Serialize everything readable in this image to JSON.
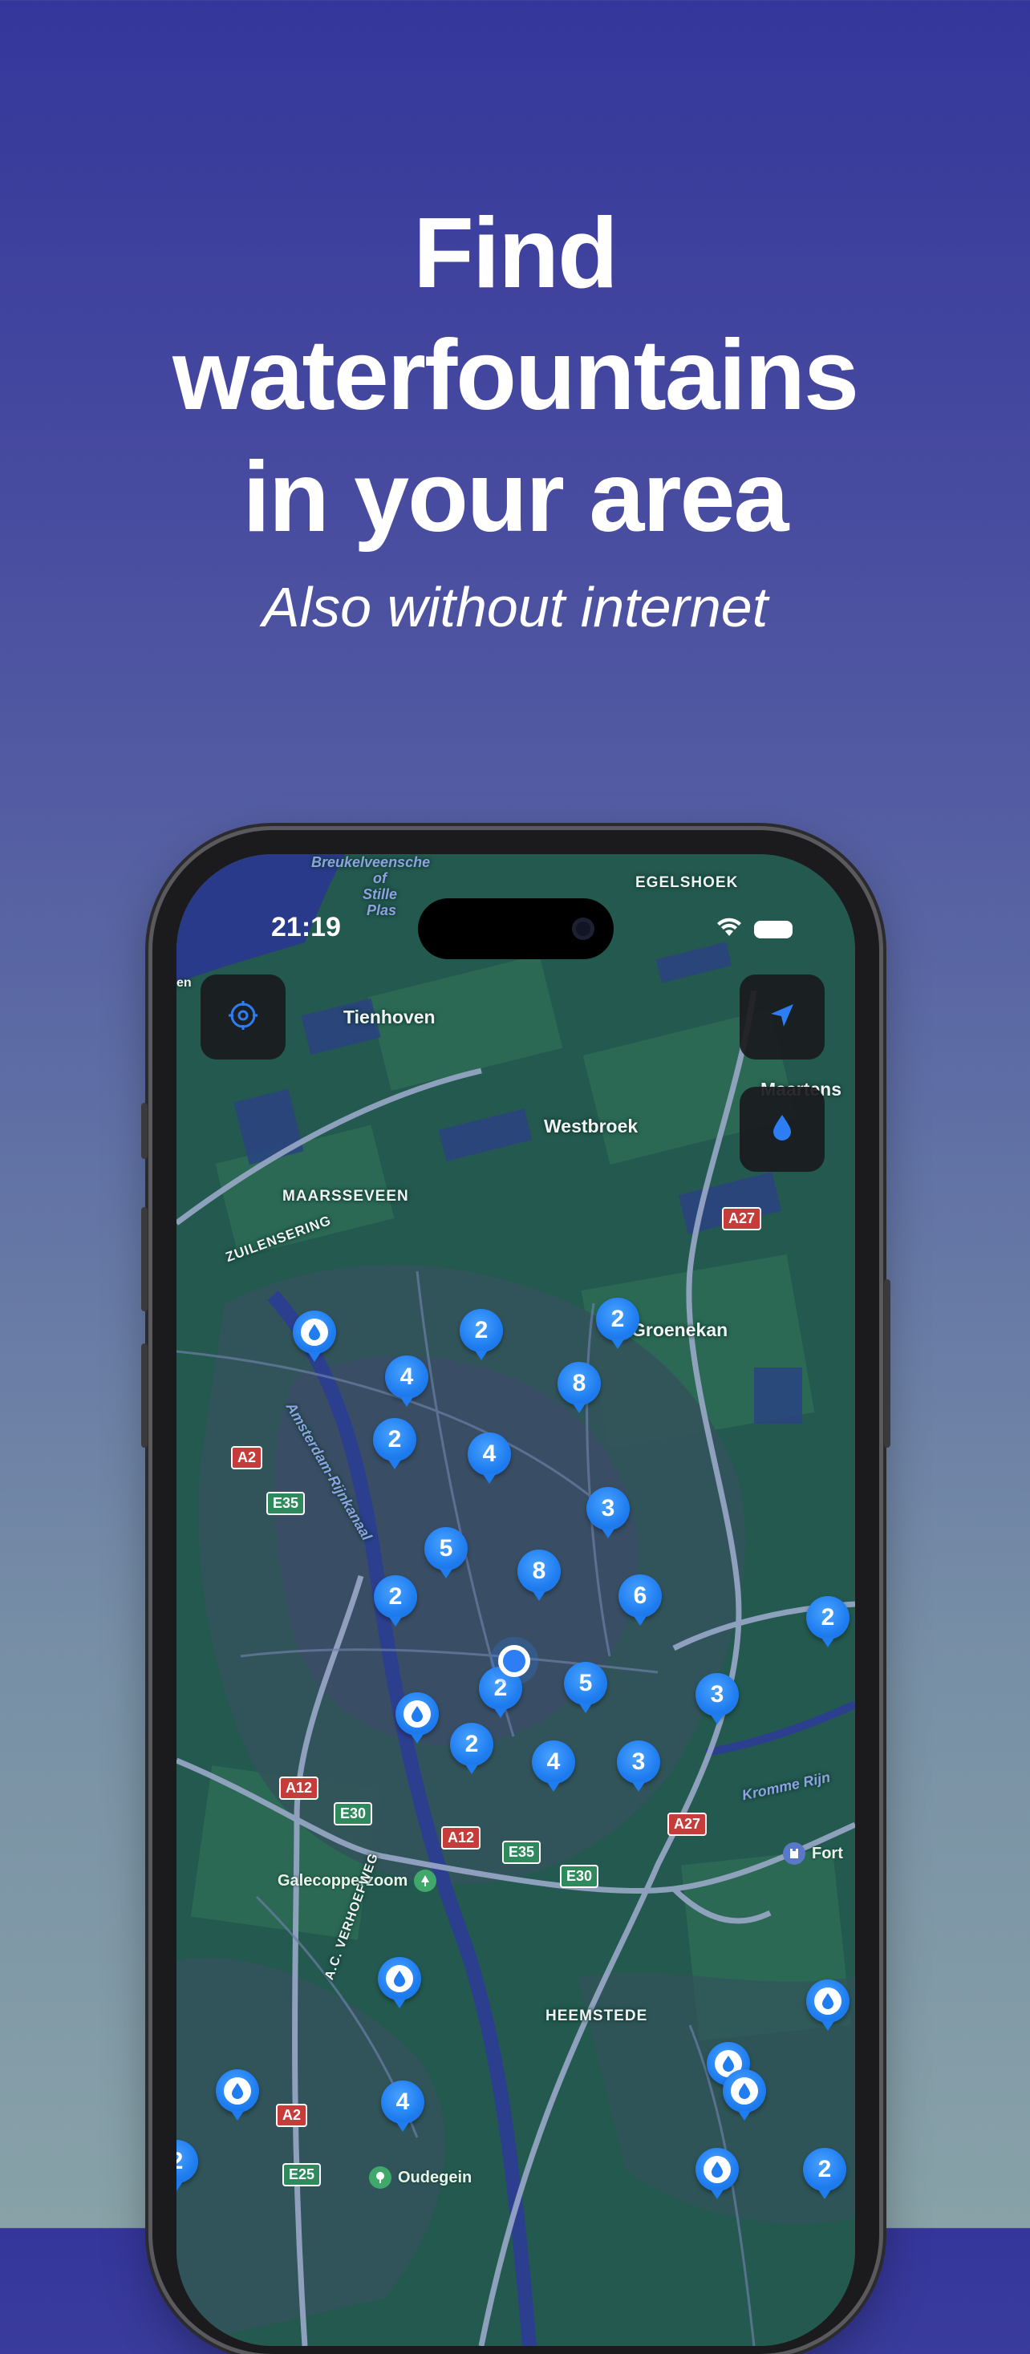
{
  "headline": [
    "Find",
    "waterfountains",
    "in your area"
  ],
  "subheadline": "Also without internet",
  "status_bar": {
    "time": "21:19"
  },
  "map_buttons": {
    "settings_icon": "gear-icon",
    "location_icon": "location-arrow-icon",
    "filter_icon": "water-drop-icon"
  },
  "map_labels": {
    "breukelveen": "Breukelveensche",
    "of": "of",
    "stille": "Stille",
    "plas": "Plas",
    "egelshoek": "EGELSHOEK",
    "tienhoven": "Tienhoven",
    "maartens": "Maartens",
    "westbroek": "Westbroek",
    "maarsseveen": "MAARSSEVEEN",
    "zuilensering": "ZUILENSERING",
    "groenekan": "Groenekan",
    "amsterdam_rijnkanaal": "Amsterdam-Rijnkanaal",
    "kromme_rijn": "Kromme Rijn",
    "galecopperzoom": "Galecopperzoom",
    "ac_verhoefweg": "A.C. VERHOEFWEG",
    "heemstede": "HEEMSTEDE",
    "fort": "Fort",
    "oudegein": "Oudegein",
    "en": "en"
  },
  "road_shields": {
    "a27_top": "A27",
    "a2_mid": "A2",
    "e35_mid": "E35",
    "a12_left": "A12",
    "e30": "E30",
    "a12_center": "A12",
    "e35_center": "E35",
    "e30_center": "E30",
    "a27_bottom": "A27",
    "a2_bottom": "A2",
    "e25": "E25"
  },
  "clusters": [
    "2",
    "2",
    "4",
    "8",
    "2",
    "4",
    "3",
    "5",
    "8",
    "2",
    "6",
    "2",
    "2",
    "5",
    "3",
    "2",
    "4",
    "3",
    "4",
    "2",
    "2"
  ],
  "colors": {
    "accent": "#1f7df0",
    "map_base": "#24594f"
  }
}
